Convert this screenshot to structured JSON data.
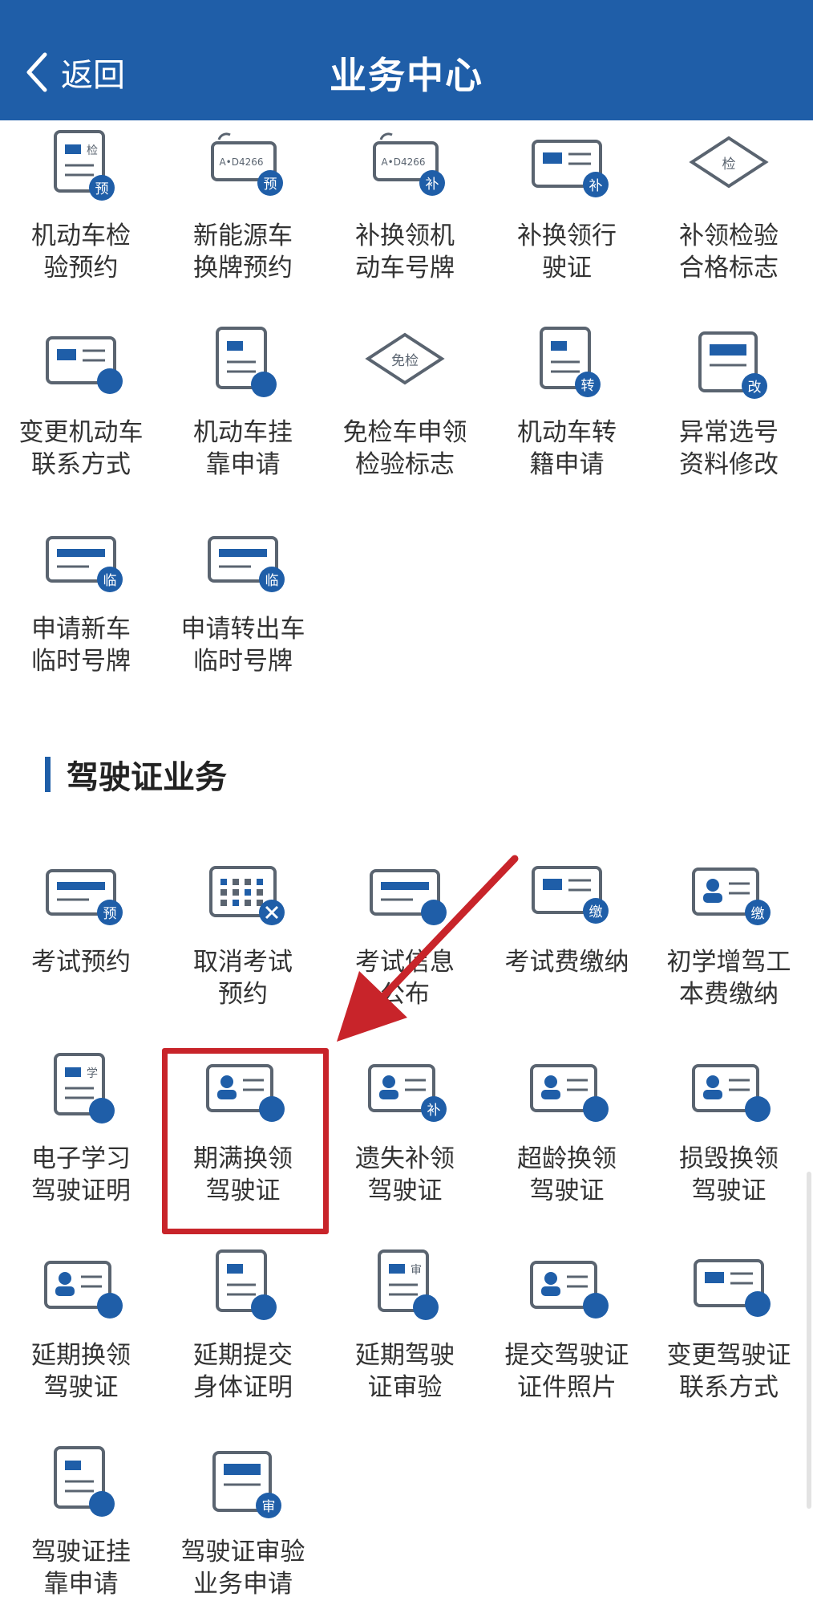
{
  "header": {
    "back_label": "返回",
    "title": "业务中心"
  },
  "vehicle_items": [
    {
      "label": "机动车检\n验预约",
      "badge": "预",
      "top_text": "检"
    },
    {
      "label": "新能源车\n换牌预约",
      "badge": "预",
      "top_text": "A•D4266"
    },
    {
      "label": "补换领机\n动车号牌",
      "badge": "补",
      "top_text": "A•D4266"
    },
    {
      "label": "补换领行\n驶证",
      "badge": "补",
      "top_text": ""
    },
    {
      "label": "补领检验\n合格标志",
      "badge": "",
      "top_text": "检"
    },
    {
      "label": "变更机动车\n联系方式",
      "badge": "",
      "top_text": ""
    },
    {
      "label": "机动车挂\n靠申请",
      "badge": "",
      "top_text": ""
    },
    {
      "label": "免检车申领\n检验标志",
      "badge": "",
      "top_text": "免检"
    },
    {
      "label": "机动车转\n籍申请",
      "badge": "转",
      "top_text": ""
    },
    {
      "label": "异常选号\n资料修改",
      "badge": "改",
      "top_text": ""
    },
    {
      "label": "申请新车\n临时号牌",
      "badge": "临",
      "top_text": ""
    },
    {
      "label": "申请转出车\n临时号牌",
      "badge": "临",
      "top_text": ""
    }
  ],
  "section": {
    "title": "驾驶证业务"
  },
  "license_items": [
    {
      "label": "考试预约",
      "badge": "预",
      "top_text": ""
    },
    {
      "label": "取消考试\n预约",
      "badge": "",
      "top_text": ""
    },
    {
      "label": "考试信息\n公布",
      "badge": "",
      "top_text": ""
    },
    {
      "label": "考试费缴纳",
      "badge": "缴",
      "top_text": ""
    },
    {
      "label": "初学增驾工\n本费缴纳",
      "badge": "缴",
      "top_text": ""
    },
    {
      "label": "电子学习\n驾驶证明",
      "badge": "",
      "top_text": "学"
    },
    {
      "label": "期满换领\n驾驶证",
      "badge": "",
      "top_text": ""
    },
    {
      "label": "遗失补领\n驾驶证",
      "badge": "补",
      "top_text": ""
    },
    {
      "label": "超龄换领\n驾驶证",
      "badge": "",
      "top_text": ""
    },
    {
      "label": "损毁换领\n驾驶证",
      "badge": "",
      "top_text": ""
    },
    {
      "label": "延期换领\n驾驶证",
      "badge": "",
      "top_text": ""
    },
    {
      "label": "延期提交\n身体证明",
      "badge": "",
      "top_text": ""
    },
    {
      "label": "延期驾驶\n证审验",
      "badge": "",
      "top_text": "审"
    },
    {
      "label": "提交驾驶证\n证件照片",
      "badge": "",
      "top_text": ""
    },
    {
      "label": "变更驾驶证\n联系方式",
      "badge": "",
      "top_text": ""
    },
    {
      "label": "驾驶证挂\n靠申请",
      "badge": "",
      "top_text": ""
    },
    {
      "label": "驾驶证审验\n业务申请",
      "badge": "审",
      "top_text": ""
    }
  ],
  "colors": {
    "brand": "#1f5ea8",
    "icon_line": "#5a6470",
    "highlight": "#c8242a"
  }
}
